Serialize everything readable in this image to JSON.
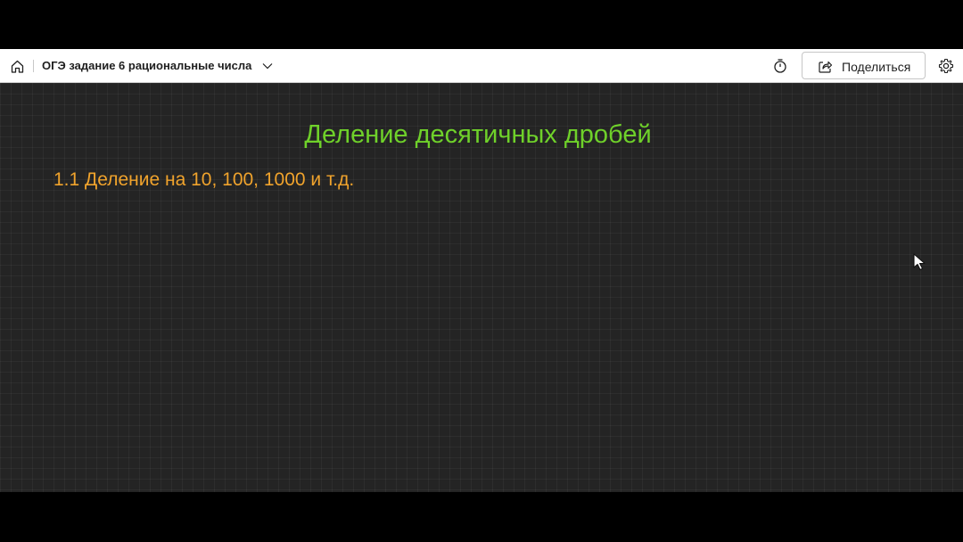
{
  "toolbar": {
    "doc_title": "ОГЭ задание 6 рациональные числа",
    "share_label": "Поделиться",
    "icons": {
      "home": "home-icon",
      "chevron": "chevron-down-icon",
      "timer": "stopwatch-icon",
      "share": "share-icon",
      "settings": "gear-icon"
    }
  },
  "slide": {
    "title": "Деление десятичных дробей",
    "subtitle": "1.1 Деление на 10, 100, 1000 и т.д.",
    "title_color": "#6fd12a",
    "subtitle_color": "#f0a32c",
    "background_color": "#242424"
  }
}
